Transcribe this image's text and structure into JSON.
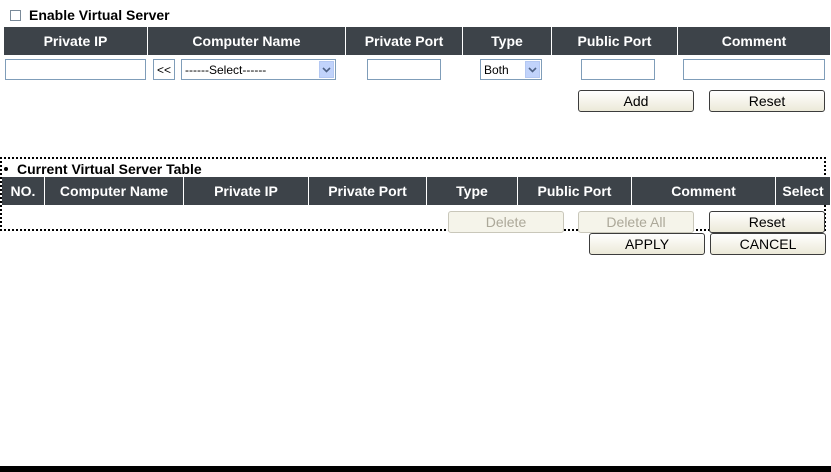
{
  "virtual_server": {
    "enable_label": "Enable Virtual Server",
    "enabled": false,
    "columns": [
      "Private IP",
      "Computer Name",
      "Private Port",
      "Type",
      "Public Port",
      "Comment"
    ],
    "copy_button_label": "<<",
    "computer_select_value": "------Select------",
    "type_select_value": "Both",
    "add_label": "Add",
    "reset_label": "Reset"
  },
  "current_table": {
    "title": "Current Virtual Server Table",
    "columns": [
      "NO.",
      "Computer Name",
      "Private IP",
      "Private Port",
      "Type",
      "Public Port",
      "Comment",
      "Select"
    ],
    "delete_label": "Delete",
    "delete_all_label": "Delete All",
    "reset_label": "Reset"
  },
  "footer": {
    "apply_label": "APPLY",
    "cancel_label": "CANCEL"
  }
}
